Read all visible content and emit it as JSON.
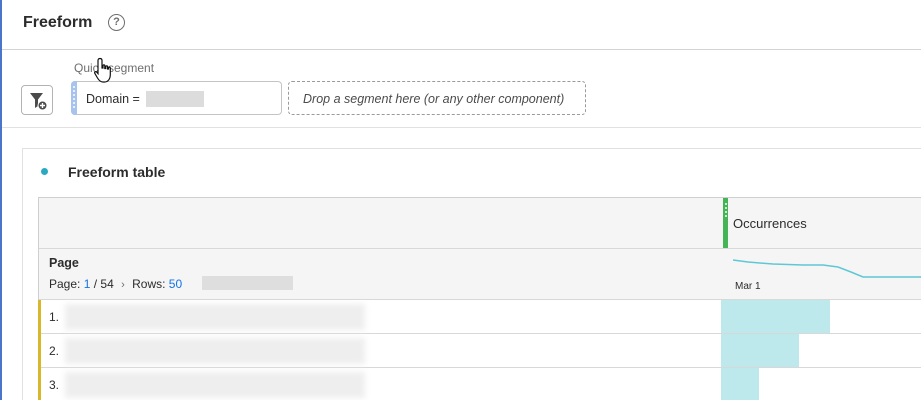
{
  "header": {
    "title": "Freeform",
    "help_icon": "?"
  },
  "segment_bar": {
    "quick_segment_label": "Quick segment",
    "quick_segment_text": "Domain =",
    "dropzone_text": "Drop a segment here (or any other component)"
  },
  "panel": {
    "title": "Freeform table",
    "dot_color": "#2aa9c3"
  },
  "table": {
    "metric_column": "Occurrences",
    "dimension": "Page",
    "pager": {
      "page_label": "Page:",
      "current_page": "1",
      "total_pages": "/ 54",
      "rows_label": "Rows:",
      "rows_value": "50"
    },
    "sparkline_date": "Mar 1",
    "rows": [
      {
        "num": "1.",
        "share": 0.52
      },
      {
        "num": "2.",
        "share": 0.37
      },
      {
        "num": "3.",
        "share": 0.18
      }
    ]
  },
  "colors": {
    "accent": "#1473e6",
    "metric_handle": "#44b556",
    "bar": "#bde9ed",
    "row_marker": "#d8b82a"
  }
}
